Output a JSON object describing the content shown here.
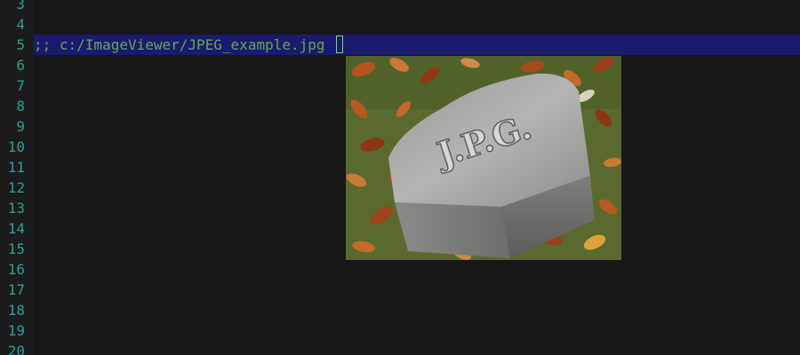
{
  "gutter": {
    "line_numbers": [
      "3",
      "4",
      "5",
      "6",
      "7",
      "8",
      "9",
      "10",
      "11",
      "12",
      "13",
      "14",
      "15",
      "16",
      "17",
      "18",
      "19",
      "20"
    ]
  },
  "editor": {
    "current_line_text": ";; c:/ImageViewer/JPEG_example.jpg",
    "accent_color": "#2aa198",
    "highlight_color": "#1a1a6e",
    "text_color": "#6aa84f"
  },
  "image": {
    "engraved_text": "J.P.G."
  }
}
